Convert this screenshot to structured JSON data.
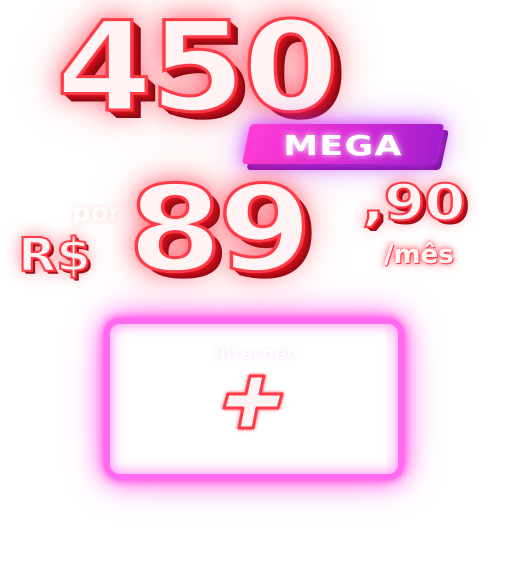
{
  "offer": {
    "speed_value": "450",
    "speed_unit": "MEGA",
    "price_prefix": "por",
    "currency": "R$",
    "price_integer": "89",
    "price_cents": ",90",
    "price_period": "/mês"
  },
  "addon_card": {
    "title": "Internet",
    "icon": "plus-icon"
  },
  "colors": {
    "primary_red": "#ff3b47",
    "depth_red": "#a00b14",
    "badge_pink": "#ff3dd6",
    "badge_purple": "#a31dcc",
    "neon_pink": "#ff6af0",
    "background": "#ffffff"
  }
}
